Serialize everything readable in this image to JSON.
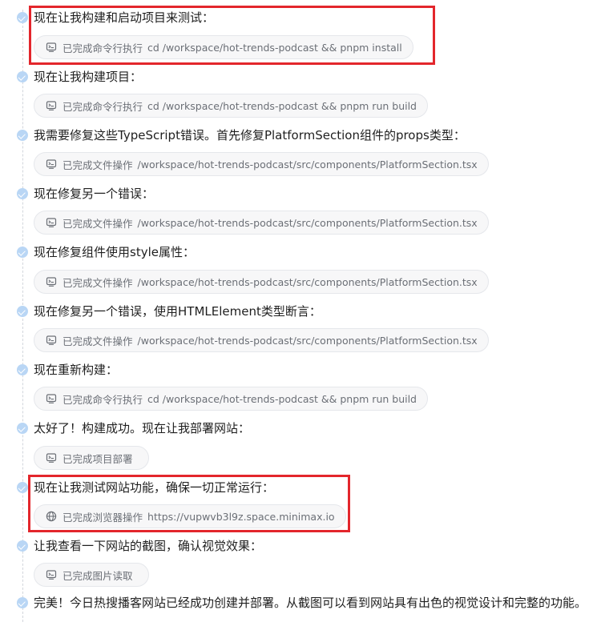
{
  "steps": [
    {
      "text": "现在让我构建和启动项目来测试：",
      "icon": "terminal-icon",
      "status": "已完成命令行执行",
      "detail": "cd /workspace/hot-trends-podcast && pnpm install"
    },
    {
      "text": "现在让我构建项目：",
      "icon": "terminal-icon",
      "status": "已完成命令行执行",
      "detail": "cd /workspace/hot-trends-podcast && pnpm run build"
    },
    {
      "text": "我需要修复这些TypeScript错误。首先修复PlatformSection组件的props类型：",
      "icon": "terminal-icon",
      "status": "已完成文件操作",
      "detail": "/workspace/hot-trends-podcast/src/components/PlatformSection.tsx"
    },
    {
      "text": "现在修复另一个错误：",
      "icon": "terminal-icon",
      "status": "已完成文件操作",
      "detail": "/workspace/hot-trends-podcast/src/components/PlatformSection.tsx"
    },
    {
      "text": "现在修复组件使用style属性：",
      "icon": "terminal-icon",
      "status": "已完成文件操作",
      "detail": "/workspace/hot-trends-podcast/src/components/PlatformSection.tsx"
    },
    {
      "text": "现在修复另一个错误，使用HTMLElement类型断言：",
      "icon": "terminal-icon",
      "status": "已完成文件操作",
      "detail": "/workspace/hot-trends-podcast/src/components/PlatformSection.tsx"
    },
    {
      "text": "现在重新构建：",
      "icon": "terminal-icon",
      "status": "已完成命令行执行",
      "detail": "cd /workspace/hot-trends-podcast && pnpm run build"
    },
    {
      "text": "太好了！构建成功。现在让我部署网站：",
      "icon": "terminal-icon",
      "status": "已完成项目部署",
      "detail": ""
    },
    {
      "text": "现在让我测试网站功能，确保一切正常运行：",
      "icon": "globe-icon",
      "status": "已完成浏览器操作",
      "detail": "https://vupwvb3l9z.space.minimax.io"
    },
    {
      "text": "让我查看一下网站的截图，确认视觉效果：",
      "icon": "terminal-icon",
      "status": "已完成图片读取",
      "detail": ""
    }
  ],
  "final_text": "完美！今日热搜播客网站已经成功创建并部署。从截图可以看到网站具有出色的视觉设计和完整的功能。",
  "colors": {
    "dot": "#b9d6f5",
    "chip_bg": "#f7f7f8",
    "chip_text": "#6b6f76",
    "highlight": "#e3262c"
  }
}
